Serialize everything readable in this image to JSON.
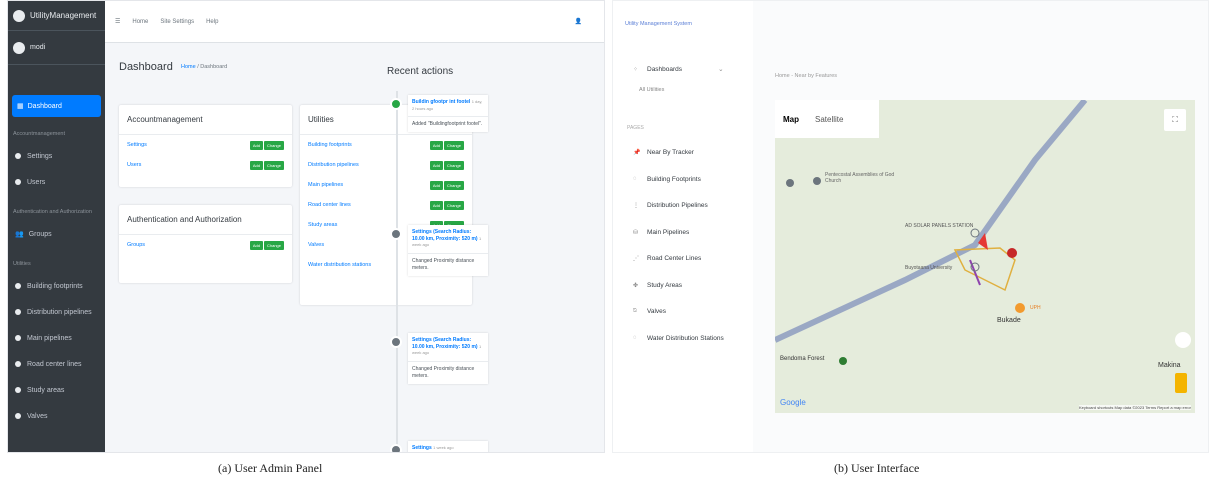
{
  "admin": {
    "brand": "UtilityManagement",
    "user": "modi",
    "nav_active": "Dashboard",
    "sections": {
      "account": "Accountmanagement",
      "auth": "Authentication and Authorization",
      "utilities": "Utilities"
    },
    "nav_items": {
      "settings": "Settings",
      "users": "Users",
      "groups": "Groups",
      "building": "Building footprints",
      "distribution": "Distribution pipelines",
      "main": "Main pipelines",
      "road": "Road center lines",
      "study": "Study areas",
      "valves": "Valves"
    },
    "topbar": {
      "home": "Home",
      "site": "Site Settings",
      "help": "Help"
    },
    "page_title": "Dashboard",
    "breadcrumb": {
      "home": "Home",
      "sep": "/",
      "current": "Dashboard"
    },
    "cards": {
      "account_title": "Accountmanagement",
      "account_rows": [
        "Settings",
        "Users"
      ],
      "auth_title": "Authentication and Authorization",
      "auth_rows": [
        "Groups"
      ],
      "util_title": "Utilities",
      "util_rows": [
        "Building footprints",
        "Distribution pipelines",
        "Main pipelines",
        "Road center lines",
        "Study areas",
        "Valves",
        "Water distribution stations"
      ],
      "add_label": "Add",
      "change_label": "Change"
    },
    "recent": {
      "title": "Recent actions",
      "items": [
        {
          "head": "Buildin gfootpr int footel",
          "time": "1 day, 2 hours ago",
          "body": "Added \"Buildingfootprint footel\"."
        },
        {
          "head": "Settings (Search Radius: 10.00 km, Proximity: 520 m)",
          "time": "1 week ago",
          "body": "Changed Proximity distance meters."
        },
        {
          "head": "Settings (Search Radius: 10.00 km, Proximity: 520 m)",
          "time": "1 week ago",
          "body": "Changed Proximity distance meters."
        },
        {
          "head": "Settings",
          "time": "1 week ago",
          "body": ""
        }
      ]
    }
  },
  "userui": {
    "brand": "Utility Management System",
    "dashboards": "Dashboards",
    "all_utilities": "All Utilities",
    "pages_header": "PAGES",
    "items": [
      "Near By Tracker",
      "Building Footprints",
      "Distribution Pipelines",
      "Main Pipelines",
      "Road Center Lines",
      "Study Areas",
      "Valves",
      "Water Distribution Stations"
    ],
    "breadcrumb": "Home - Near by Features",
    "map": {
      "map_label": "Map",
      "satellite_label": "Satellite",
      "places": [
        "Pentecostal Assemblies of God Church",
        "AD SOLAR PANELS STATION",
        "Buyotaana University",
        "Bukade",
        "Makina",
        "UPH",
        "Bendoma Forest"
      ],
      "footer": "Keyboard shortcuts   Map data ©2023   Terms   Report a map error",
      "google": "Google"
    }
  },
  "captions": {
    "a": "(a) User Admin Panel",
    "b": "(b) User Interface"
  }
}
